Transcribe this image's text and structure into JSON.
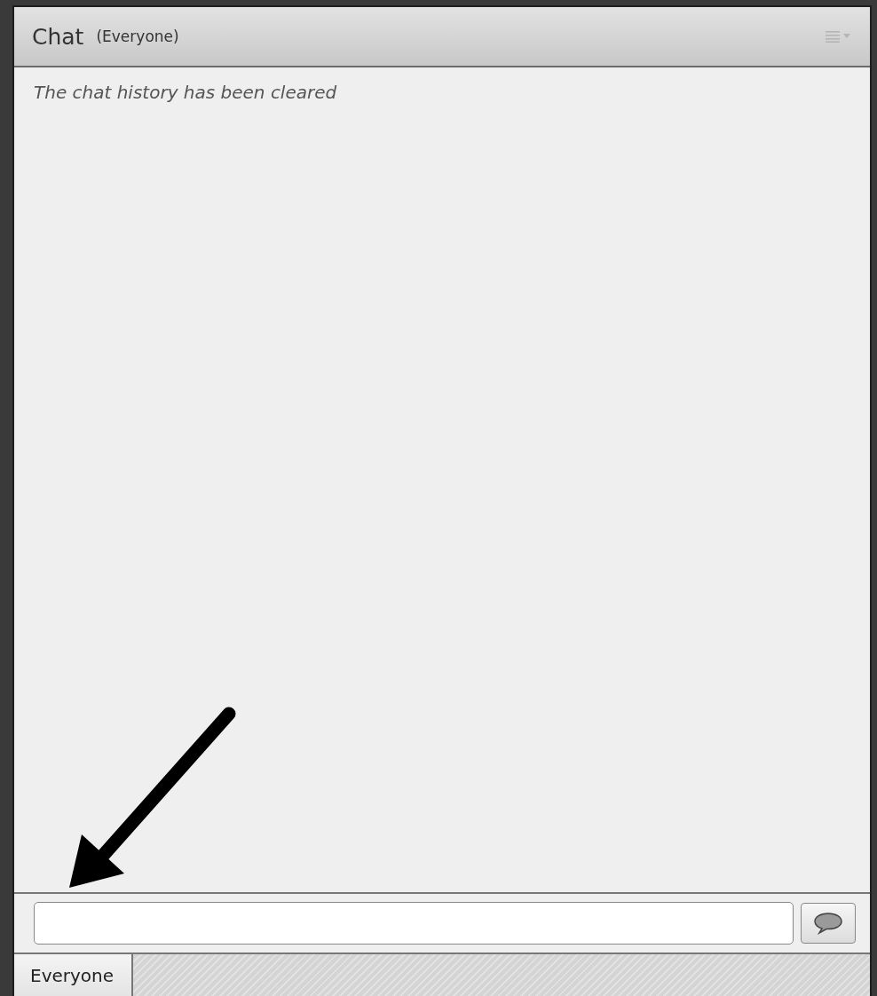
{
  "header": {
    "title": "Chat",
    "audience": "(Everyone)"
  },
  "messages": [
    {
      "kind": "system",
      "text": "The chat history has been cleared"
    }
  ],
  "tabs": [
    {
      "label": "Everyone",
      "selected": true
    }
  ]
}
